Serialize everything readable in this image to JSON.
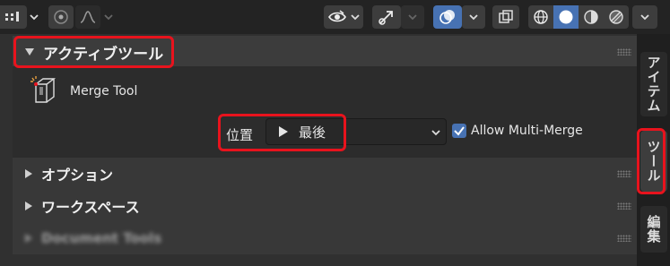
{
  "panels": {
    "active_tool": {
      "title": "アクティブツール",
      "tool_name": "Merge Tool",
      "position_label": "位置",
      "position_value": "最後",
      "checkbox_label": "Allow Multi-Merge",
      "checkbox_checked": true
    },
    "options": {
      "title": "オプション"
    },
    "workspace": {
      "title": "ワークスペース"
    },
    "blurred": {
      "title": "Document Tools"
    }
  },
  "sidebar": {
    "tabs": [
      "アイテム",
      "ツール",
      "編集"
    ],
    "active_tab": "ツール"
  },
  "header": {
    "icons": [
      "select-mode-icon",
      "proportional-editing-icon",
      "falloff-curve-icon",
      "visibility-icon",
      "gizmo-icon",
      "overlay-icon",
      "xray-icon",
      "wireframe-shading-icon",
      "solid-shading-icon",
      "material-shading-icon",
      "rendered-shading-icon"
    ]
  },
  "colors": {
    "highlight": "#e8131d",
    "active": "#4772b3",
    "checkbox": "#4772b3"
  }
}
